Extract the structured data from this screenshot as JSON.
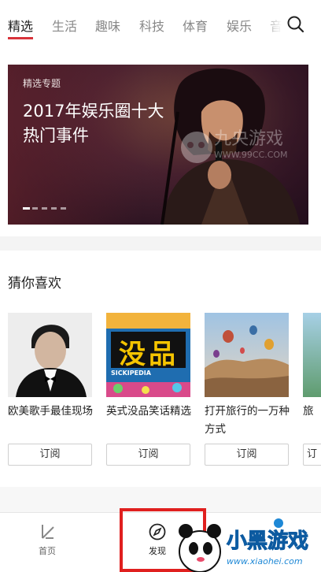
{
  "tabs": {
    "items": [
      "精选",
      "生活",
      "趣味",
      "科技",
      "体育",
      "娱乐",
      "音"
    ],
    "active_index": 0
  },
  "banner": {
    "tag": "精选专题",
    "title": "2017年娱乐圈十大热门事件"
  },
  "recommend": {
    "title": "猜你喜欢",
    "cards": [
      {
        "title": "欧美歌手最佳现场",
        "button": "订阅"
      },
      {
        "title": "英式没品笑话精选",
        "button": "订阅"
      },
      {
        "title": "打开旅行的一万种方式",
        "button": "订阅"
      },
      {
        "title": "旅",
        "button": "订"
      }
    ],
    "album_art_text": "没品",
    "album_art_sub": "SICKIPEDIA"
  },
  "bottom_nav": {
    "items": [
      "首页",
      "发现"
    ],
    "active_index": 1
  },
  "watermarks": {
    "banner_logo_text": "九央游戏",
    "banner_logo_url": "WWW.99CC.COM",
    "corner_logo_text": "小黑游戏",
    "corner_logo_url": "www.xiaohei.com"
  },
  "colors": {
    "accent": "#d8333a",
    "highlight_box": "#e0201f"
  }
}
